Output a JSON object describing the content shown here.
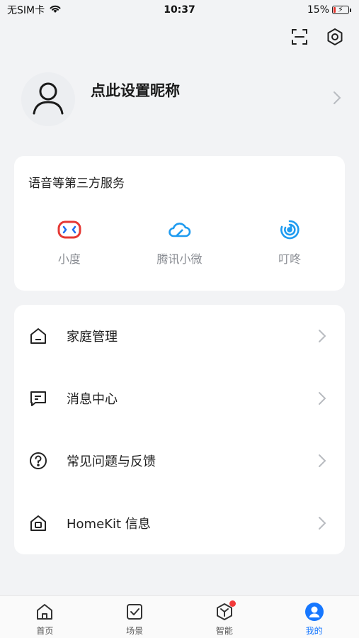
{
  "status_bar": {
    "carrier": "无SIM卡",
    "time": "10:37",
    "battery_percent_text": "15%",
    "battery_level": 0.15
  },
  "top_actions": {
    "scan_icon": "scan-icon",
    "settings_icon": "settings-hex-icon"
  },
  "profile": {
    "nickname": "点此设置昵称",
    "avatar_icon": "user-outline-icon"
  },
  "services": {
    "title": "语音等第三方服务",
    "items": [
      {
        "label": "小度",
        "icon": "xiaodu-icon",
        "color": "#e53935"
      },
      {
        "label": "腾讯小微",
        "icon": "cloud-icon",
        "color": "#1e9bf0"
      },
      {
        "label": "叮咚",
        "icon": "dingdong-icon",
        "color": "#1e9bf0"
      }
    ]
  },
  "menu": {
    "items": [
      {
        "label": "家庭管理",
        "icon": "home-icon"
      },
      {
        "label": "消息中心",
        "icon": "message-icon"
      },
      {
        "label": "常见问题与反馈",
        "icon": "question-icon"
      },
      {
        "label": "HomeKit 信息",
        "icon": "homekit-icon"
      }
    ]
  },
  "tabs": [
    {
      "label": "首页",
      "icon": "home-tab-icon",
      "active": false
    },
    {
      "label": "场景",
      "icon": "scene-check-icon",
      "active": false
    },
    {
      "label": "智能",
      "icon": "smart-cube-icon",
      "active": false,
      "badge": true
    },
    {
      "label": "我的",
      "icon": "profile-tab-icon",
      "active": true
    }
  ],
  "colors": {
    "accent": "#1677ff",
    "background": "#f2f3f5",
    "card": "#ffffff",
    "badge": "#f23b3b",
    "battery_low": "#e5362f"
  }
}
